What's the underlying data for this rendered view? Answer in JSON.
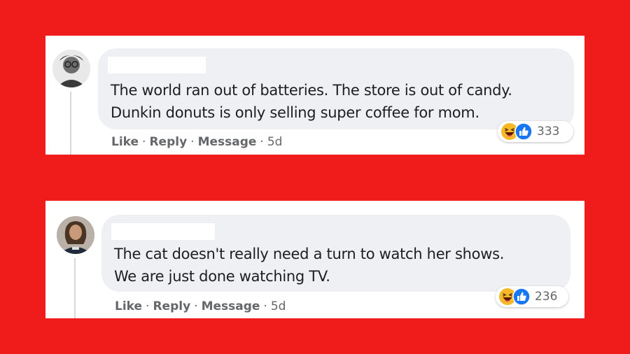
{
  "comments": [
    {
      "text": "The world ran out of batteries. The store is out of candy.\nDunkin donuts is only selling super coffee for mom.",
      "actions": {
        "like": "Like",
        "reply": "Reply",
        "message": "Message",
        "sep": "·",
        "time": "5d"
      },
      "reaction_count": "333",
      "reaction_icons": [
        "haha-icon",
        "like-icon"
      ]
    },
    {
      "text": "The cat doesn't really need a turn to watch her shows.\nWe are just done watching TV.",
      "actions": {
        "like": "Like",
        "reply": "Reply",
        "message": "Message",
        "sep": "·",
        "time": "5d"
      },
      "reaction_count": "236",
      "reaction_icons": [
        "haha-icon",
        "like-icon"
      ]
    }
  ],
  "colors": {
    "background": "#f01c1c",
    "bubble": "#eef0f3",
    "meta_text": "#65676b",
    "like_blue": "#1877f2",
    "haha_yellow": "#f7b928"
  }
}
